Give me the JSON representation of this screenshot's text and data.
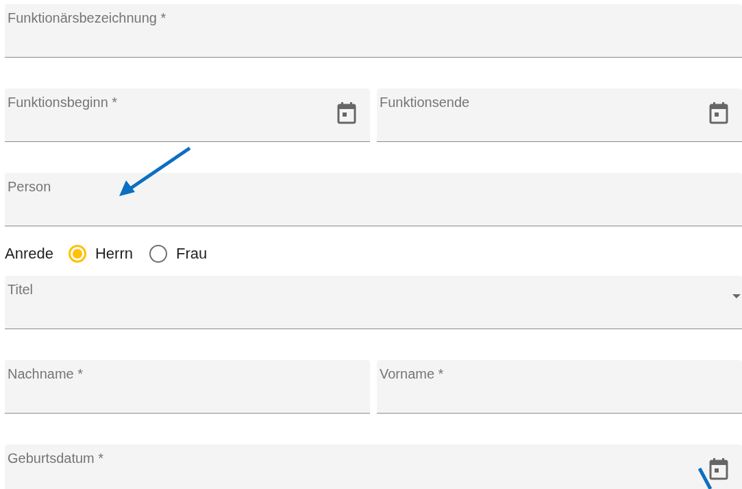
{
  "rows": [
    {
      "kind": "fields",
      "fields": [
        {
          "kind": "text",
          "placeholder": "Funktionärsbezeichnung *"
        }
      ]
    },
    {
      "kind": "fields",
      "fields": [
        {
          "kind": "date",
          "placeholder": "Funktionsbeginn *"
        },
        {
          "kind": "date",
          "placeholder": "Funktionsende"
        }
      ]
    },
    {
      "kind": "fields",
      "fields": [
        {
          "kind": "text",
          "placeholder": "Person"
        }
      ]
    },
    {
      "kind": "radio",
      "label": "Anrede",
      "options": [
        {
          "label": "Herrn",
          "selected": true
        },
        {
          "label": "Frau",
          "selected": false
        }
      ]
    },
    {
      "kind": "fields",
      "fields": [
        {
          "kind": "select",
          "placeholder": "Titel"
        }
      ]
    },
    {
      "kind": "fields",
      "fields": [
        {
          "kind": "text",
          "placeholder": "Nachname *"
        },
        {
          "kind": "text",
          "placeholder": "Vorname *"
        }
      ]
    },
    {
      "kind": "fields",
      "fields": [
        {
          "kind": "date",
          "placeholder": "Geburtsdatum *"
        }
      ]
    }
  ]
}
